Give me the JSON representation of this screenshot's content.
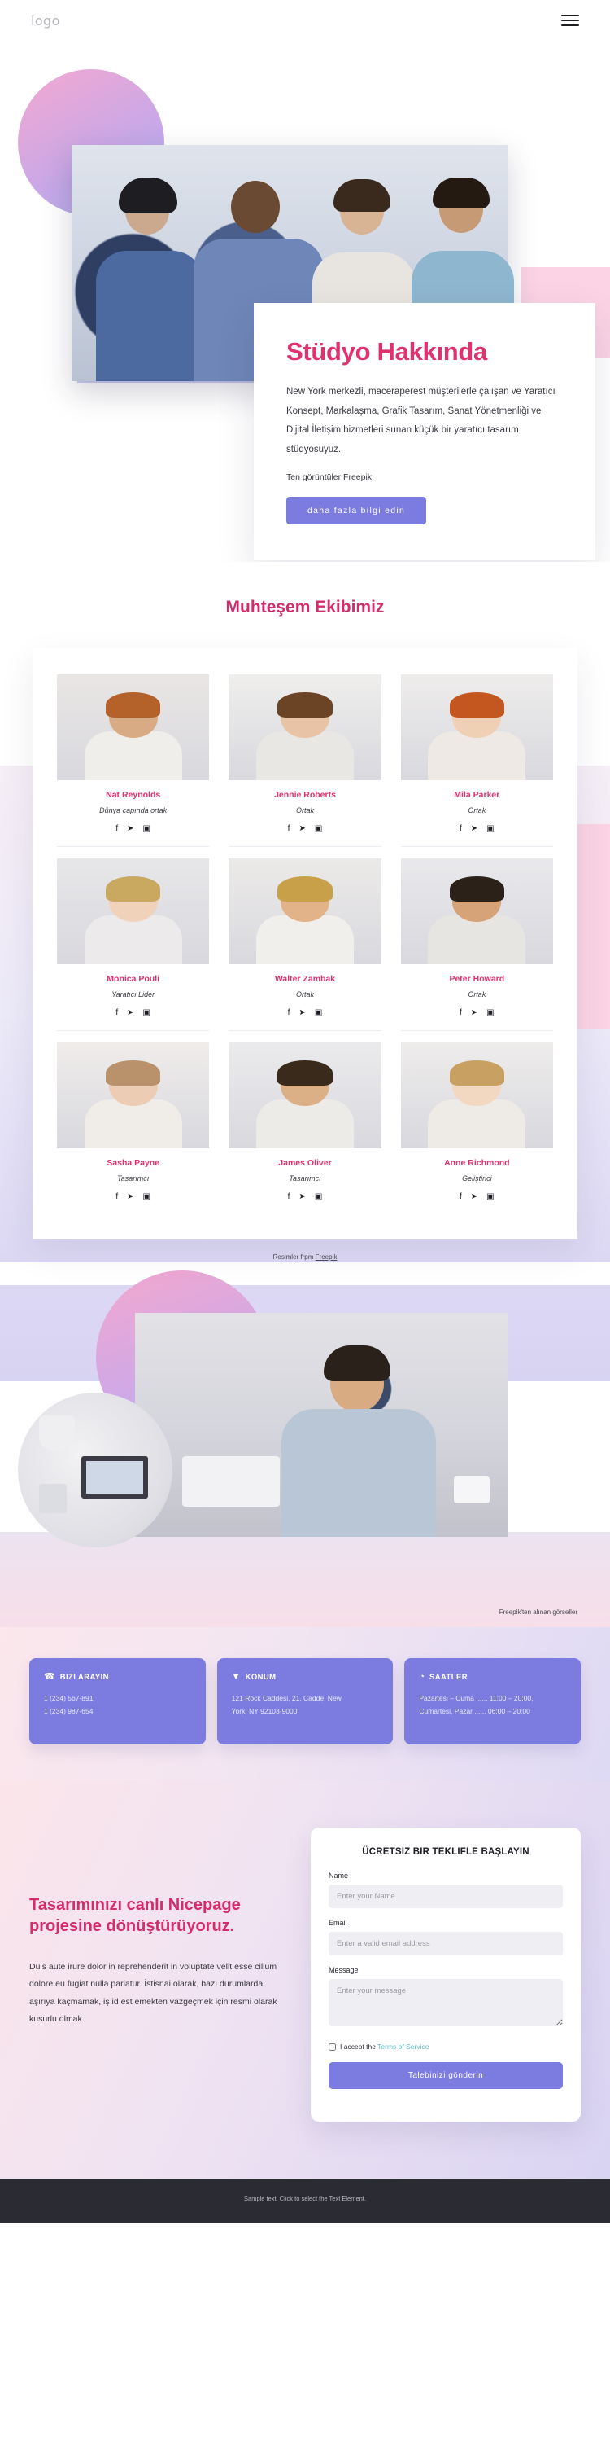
{
  "header": {
    "logo": "logo",
    "menu_icon": "hamburger-menu-icon"
  },
  "hero": {
    "title": "Stüdyo Hakkında",
    "body": "New York merkezli, maceraperest müşterilerle çalışan ve Yaratıcı Konsept, Markalaşma, Grafik Tasarım, Sanat Yönetmenliği ve Dijital İletişim hizmetleri sunan küçük bir yaratıcı tasarım stüdyosuyuz.",
    "credit_prefix": "Ten görüntüler ",
    "credit_link": "Freepik",
    "cta": "daha fazla bilgi edin",
    "accent": "#e1316f",
    "button_color": "#7b7be0"
  },
  "team": {
    "heading": "Muhteşem Ekibimiz",
    "credit_prefix": "Resimler frpm ",
    "credit_link": "Freepik",
    "social": [
      "f",
      "✈",
      "▣"
    ],
    "members": [
      {
        "name": "Nat Reynolds",
        "role": "Dünya çapında ortak"
      },
      {
        "name": "Jennie Roberts",
        "role": "Ortak"
      },
      {
        "name": "Mila Parker",
        "role": "Ortak"
      },
      {
        "name": "Monica Pouli",
        "role": "Yaratıcı Lider"
      },
      {
        "name": "Walter Zambak",
        "role": "Ortak"
      },
      {
        "name": "Peter Howard",
        "role": "Ortak"
      },
      {
        "name": "Sasha Payne",
        "role": "Tasarımcı"
      },
      {
        "name": "James Oliver",
        "role": "Tasarımcı"
      },
      {
        "name": "Anne Richmond",
        "role": "Geliştirici"
      }
    ]
  },
  "showcase": {
    "credit_prefix": "Freepik'ten alınan görseller",
    "credit_link": ""
  },
  "info_cards": [
    {
      "icon": "phone-icon",
      "title": "BIZI ARAYIN",
      "lines": [
        "1 (234) 567-891,",
        "1 (234) 987-654"
      ]
    },
    {
      "icon": "map-pin-icon",
      "title": "KONUM",
      "lines": [
        "121 Rock Caddesi, 21. Cadde, New",
        "York, NY 92103-9000"
      ]
    },
    {
      "icon": "clock-icon",
      "title": "SAATLER",
      "lines": [
        "Pazartesi – Cuma ...... 11:00 – 20:00,",
        "Cumartesi, Pazar  ...... 06:00 – 20:00"
      ]
    }
  ],
  "contact": {
    "title": "Tasarımınızı canlı Nicepage projesine dönüştürüyoruz.",
    "body": "Duis aute irure dolor in reprehenderit in voluptate velit esse cillum dolore eu fugiat nulla pariatur. İstisnai olarak, bazı durumlarda aşırıya kaçmamak, iş id est emekten vazgeçmek için resmi olarak kusurlu olmak.",
    "form": {
      "title": "ÜCRETSIZ BIR TEKLIFLE BAŞLAYIN",
      "name_label": "Name",
      "name_placeholder": "Enter your Name",
      "name_value": "",
      "email_label": "Email",
      "email_placeholder": "Enter a valid email address",
      "email_value": "",
      "message_label": "Message",
      "message_placeholder": "Enter your message",
      "message_value": "",
      "consent_text": "I accept the ",
      "consent_link": "Terms of Service",
      "submit": "Talebinizi gönderin"
    }
  },
  "footer": {
    "text": "Sample text. Click to select the Text Element."
  }
}
